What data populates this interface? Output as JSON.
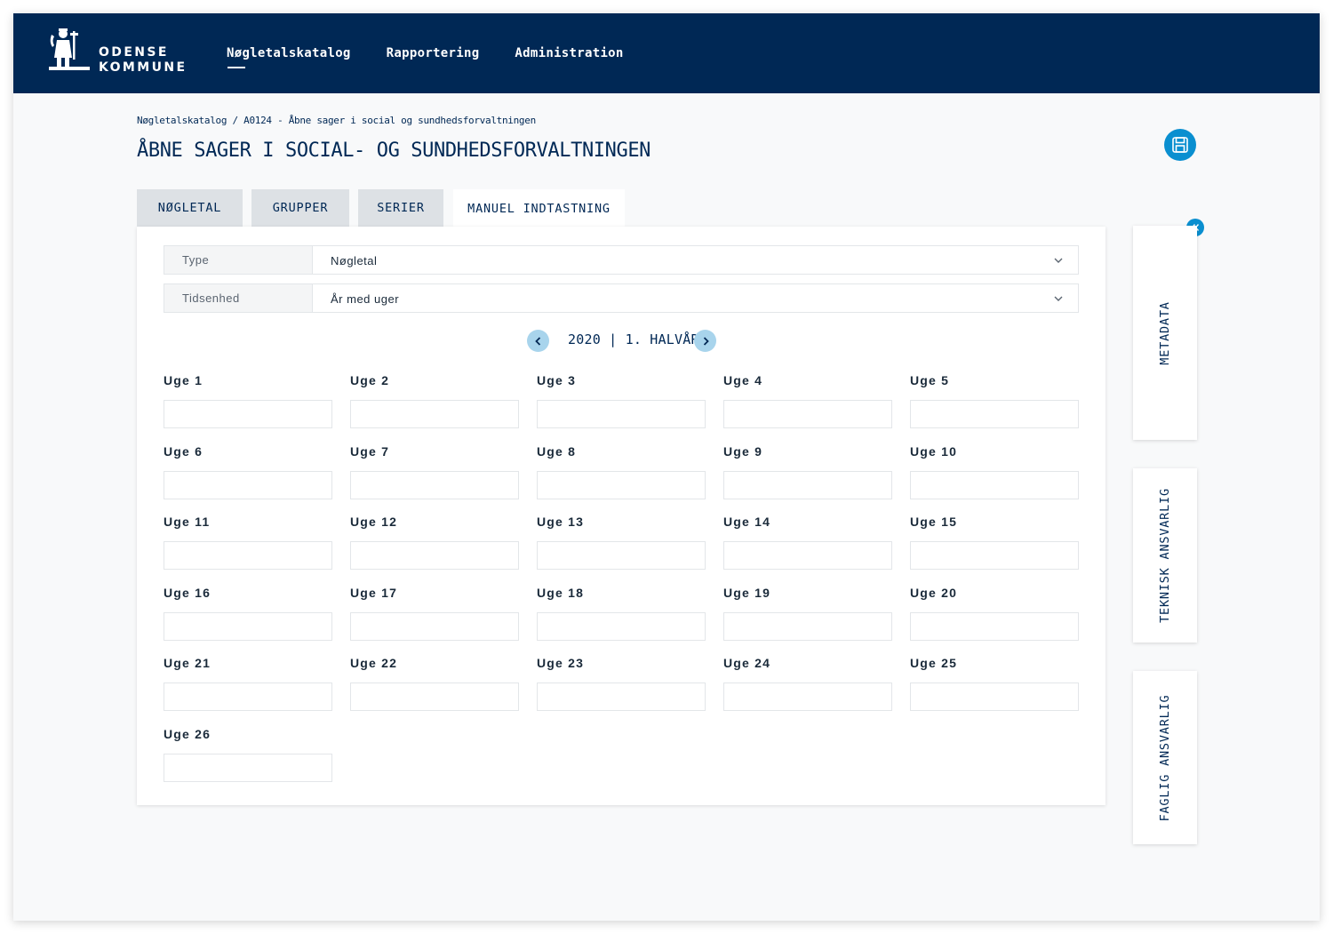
{
  "header": {
    "logo": {
      "line1": "ODENSE",
      "line2": "KOMMUNE"
    },
    "nav": [
      {
        "label": "Nøgletalskatalog"
      },
      {
        "label": "Rapportering"
      },
      {
        "label": "Administration"
      }
    ]
  },
  "breadcrumb": "Nøgletalskatalog / A0124 - Åbne sager i social og sundhedsforvaltningen",
  "title": "ÅBNE SAGER I SOCIAL- OG SUNDHEDSFORVALTNINGEN",
  "tabs": [
    {
      "label": "NØGLETAL"
    },
    {
      "label": "GRUPPER"
    },
    {
      "label": "SERIER"
    },
    {
      "label": "MANUEL INDTASTNING"
    }
  ],
  "form": {
    "type": {
      "label": "Type",
      "value": "Nøgletal"
    },
    "timeunit": {
      "label": "Tidsenhed",
      "value": "År med uger"
    }
  },
  "period": {
    "label": "2020 | 1. HALVÅR"
  },
  "weeks": [
    "Uge 1",
    "Uge 2",
    "Uge 3",
    "Uge 4",
    "Uge 5",
    "Uge 6",
    "Uge 7",
    "Uge 8",
    "Uge 9",
    "Uge 10",
    "Uge 11",
    "Uge 12",
    "Uge 13",
    "Uge 14",
    "Uge 15",
    "Uge 16",
    "Uge 17",
    "Uge 18",
    "Uge 19",
    "Uge 20",
    "Uge 21",
    "Uge 22",
    "Uge 23",
    "Uge 24",
    "Uge 25",
    "Uge 26"
  ],
  "side": [
    {
      "label": "METADATA"
    },
    {
      "label": "TEKNISK ANSVARLIG"
    },
    {
      "label": "FAGLIG ANSVARLIG"
    }
  ],
  "colors": {
    "navy": "#002855",
    "accent": "#0a8fd0",
    "light_accent": "#a8d4ec"
  },
  "icons": [
    "crest-logo",
    "save-icon",
    "chevron-down-icon",
    "chevron-left-icon",
    "chevron-right-icon",
    "double-chevron-left-icon"
  ]
}
